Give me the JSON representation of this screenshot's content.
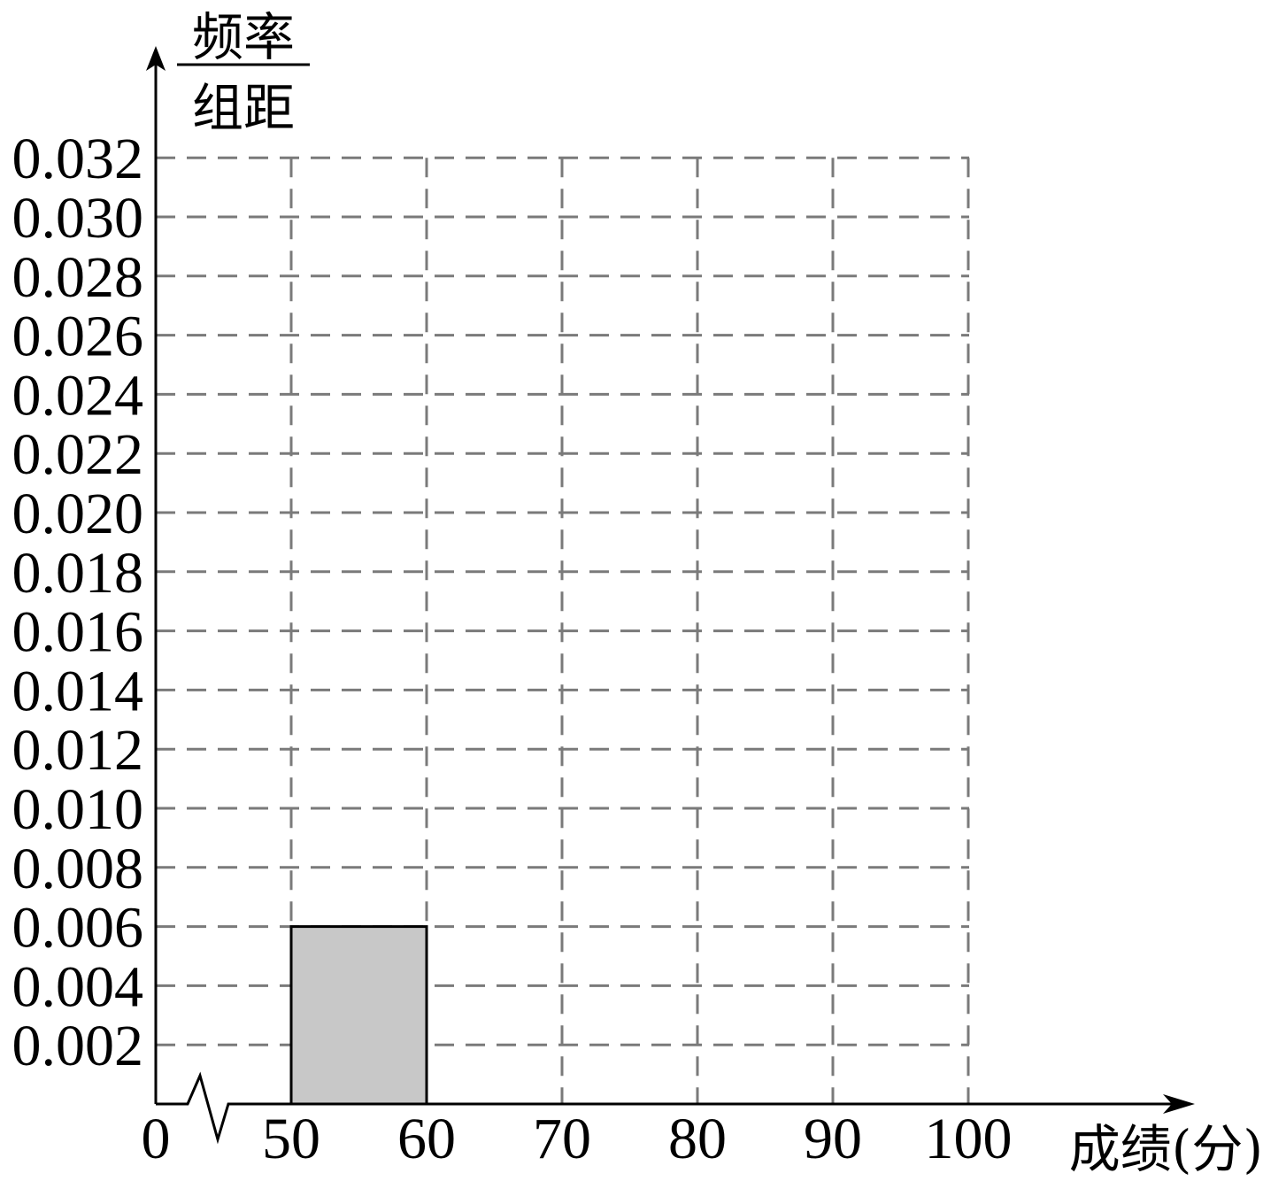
{
  "chart_data": {
    "type": "bar",
    "subtype": "histogram",
    "bins": [
      {
        "label": "50-60",
        "start": 50,
        "end": 60,
        "value": 0.006
      }
    ],
    "x_tick_labels": [
      "0",
      "50",
      "60",
      "70",
      "80",
      "90",
      "100"
    ],
    "x_ticks": [
      50,
      60,
      70,
      80,
      90,
      100
    ],
    "y_tick_labels": [
      "0.002",
      "0.004",
      "0.006",
      "0.008",
      "0.010",
      "0.012",
      "0.014",
      "0.016",
      "0.018",
      "0.020",
      "0.022",
      "0.024",
      "0.026",
      "0.028",
      "0.030",
      "0.032"
    ],
    "y_ticks": [
      0.002,
      0.004,
      0.006,
      0.008,
      0.01,
      0.012,
      0.014,
      0.016,
      0.018,
      0.02,
      0.022,
      0.024,
      0.026,
      0.028,
      0.03,
      0.032
    ],
    "xlabel": "成绩(分)",
    "ylabel_numerator": "频率",
    "ylabel_denominator": "组距",
    "xlim": [
      50,
      100
    ],
    "ylim": [
      0,
      0.032
    ],
    "x_axis_break": true,
    "grid": "dashed",
    "colors": {
      "bar_fill": "#c8c8c8",
      "grid": "#7a7a7a",
      "axis": "#000000"
    }
  }
}
